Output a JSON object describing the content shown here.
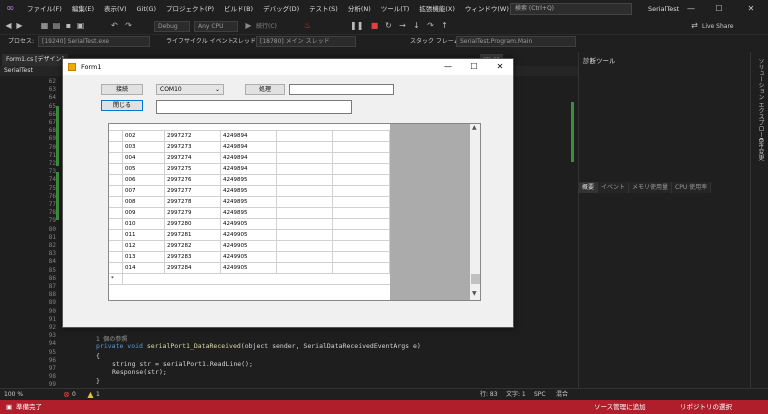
{
  "titlebar": {
    "menu": [
      "ファイル(F)",
      "編集(E)",
      "表示(V)",
      "Git(G)",
      "プロジェクト(P)",
      "ビルド(B)",
      "デバッグ(D)",
      "テスト(S)",
      "分析(N)",
      "ツール(T)",
      "拡張機能(X)",
      "ウィンドウ(W)",
      "ヘルプ(H)"
    ],
    "search_placeholder": "検索 (Ctrl+Q)",
    "app_title": "SerialTest"
  },
  "toolbar": {
    "config": "Debug",
    "platform": "Any CPU",
    "continue": "続行(C)",
    "live_share": "Live Share",
    "process_label": "プロセス:",
    "process_value": "[19240] SerialTest.exe",
    "lifecycle": "ライフサイクル イベント",
    "thread_label": "スレッド:",
    "thread_value": "[18780] メイン スレッド",
    "stackframe_label": "スタック フレーム:",
    "stackframe_value": "SerialTest.Program.Main"
  },
  "editor": {
    "tab_left": "Form1.cs [デザイン]",
    "tab_right": "rm.cs",
    "nav_left": "SerialTest",
    "line_numbers": [
      "62",
      "63",
      "64",
      "65",
      "66",
      "67",
      "68",
      "69",
      "70",
      "71",
      "72",
      "73",
      "74",
      "75",
      "76",
      "77",
      "78",
      "79",
      "80",
      "81",
      "82",
      "83",
      "84",
      "85",
      "86",
      "87",
      "88",
      "89",
      "90",
      "91",
      "92",
      "93",
      "94",
      "95",
      "96",
      "97",
      "98",
      "99"
    ],
    "code_refs": "1 個の参照",
    "code_line1_kw": "private void ",
    "code_line1_name": "serialPort1_DataReceived",
    "code_line1_args": "(object sender, SerialDataReceivedEventArgs e)",
    "code_brace_open": "{",
    "code_line2": "string str = serialPort1.ReadLine();",
    "code_line3": "Response(str);",
    "code_brace_close": "}"
  },
  "right_panel": {
    "title": "診断ツール",
    "tabs": [
      "概要",
      "イベント",
      "メモリ使用量",
      "CPU 使用率"
    ],
    "side_labels": [
      "ソリューション エクスプローラー",
      "Git 変更"
    ]
  },
  "editor_status": {
    "zoom": "100 %",
    "errors": "0",
    "warnings": "1",
    "line": "行: 83",
    "char": "文字: 1",
    "spc": "SPC",
    "mixed": "混合"
  },
  "statusbar": {
    "ready": "準備完了",
    "source_control": "ソース管理に追加",
    "repo": "リポジトリの選択"
  },
  "form1": {
    "title": "Form1",
    "connect_label": "接続",
    "disconnect_label": "閉じる",
    "port_value": "COM10",
    "process_label": "処理",
    "grid_rows": [
      [
        "002",
        "2997272",
        "4249894"
      ],
      [
        "003",
        "2997273",
        "4249894"
      ],
      [
        "004",
        "2997274",
        "4249894"
      ],
      [
        "005",
        "2997275",
        "4249894"
      ],
      [
        "006",
        "2997276",
        "4249895"
      ],
      [
        "007",
        "2997277",
        "4249895"
      ],
      [
        "008",
        "2997278",
        "4249895"
      ],
      [
        "009",
        "2997279",
        "4249895"
      ],
      [
        "010",
        "2997280",
        "4249905"
      ],
      [
        "011",
        "2997281",
        "4249905"
      ],
      [
        "012",
        "2997282",
        "4249905"
      ],
      [
        "013",
        "2997283",
        "4249905"
      ],
      [
        "014",
        "2997284",
        "4249905"
      ]
    ],
    "new_row_marker": "*"
  }
}
